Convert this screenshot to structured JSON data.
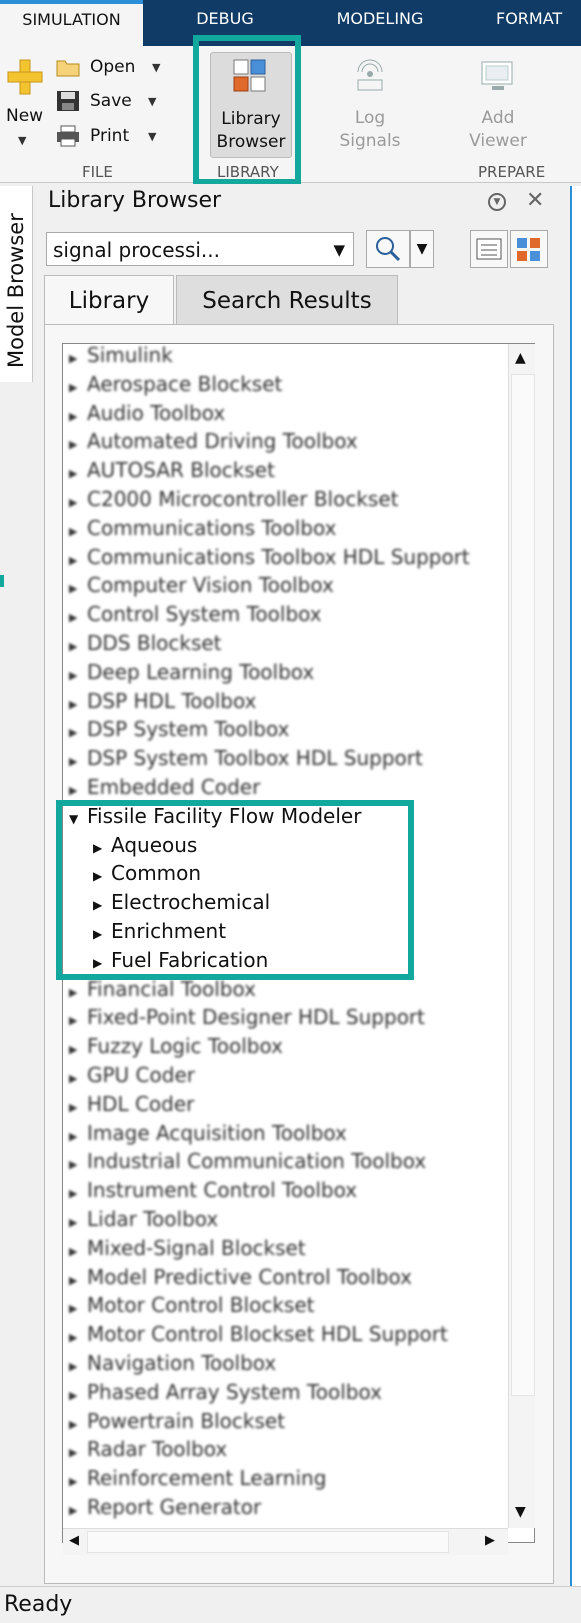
{
  "tabs": [
    "SIMULATION",
    "DEBUG",
    "MODELING",
    "FORMAT"
  ],
  "ribbon": {
    "new_label": "New",
    "open_label": "Open",
    "save_label": "Save",
    "print_label": "Print",
    "file_group": "FILE",
    "library_browser_label_1": "Library",
    "library_browser_label_2": "Browser",
    "library_group": "LIBRARY",
    "log_signals_1": "Log",
    "log_signals_2": "Signals",
    "add_viewer_1": "Add",
    "add_viewer_2": "Viewer",
    "prepare_group": "PREPARE"
  },
  "side": {
    "model_browser": "Model Browser"
  },
  "panel": {
    "title": "Library Browser",
    "search_value": "signal processi...",
    "tab_library": "Library",
    "tab_search": "Search Results"
  },
  "tree": {
    "blurred_top": [
      "Simulink",
      "Aerospace Blockset",
      "Audio Toolbox",
      "Automated Driving Toolbox",
      "AUTOSAR Blockset",
      "C2000 Microcontroller Blockset",
      "Communications Toolbox",
      "Communications Toolbox HDL Support",
      "Computer Vision Toolbox",
      "Control System Toolbox",
      "DDS Blockset",
      "Deep Learning Toolbox",
      "DSP HDL Toolbox",
      "DSP System Toolbox",
      "DSP System Toolbox HDL Support",
      "Embedded Coder"
    ],
    "expanded": {
      "label": "Fissile Facility Flow Modeler",
      "children": [
        "Aqueous",
        "Common",
        "Electrochemical",
        "Enrichment",
        "Fuel Fabrication"
      ]
    },
    "blurred_bottom": [
      "Financial Toolbox",
      "Fixed-Point Designer HDL Support",
      "Fuzzy Logic Toolbox",
      "GPU Coder",
      "HDL Coder",
      "Image Acquisition Toolbox",
      "Industrial Communication Toolbox",
      "Instrument Control Toolbox",
      "Lidar Toolbox",
      "Mixed-Signal Blockset",
      "Model Predictive Control Toolbox",
      "Motor Control Blockset",
      "Motor Control Blockset HDL Support",
      "Navigation Toolbox",
      "Phased Array System Toolbox",
      "Powertrain Blockset",
      "Radar Toolbox",
      "Reinforcement Learning",
      "Report Generator"
    ]
  },
  "status": "Ready",
  "colors": {
    "highlight": "#13a89e",
    "tabbar": "#0f3b66"
  }
}
